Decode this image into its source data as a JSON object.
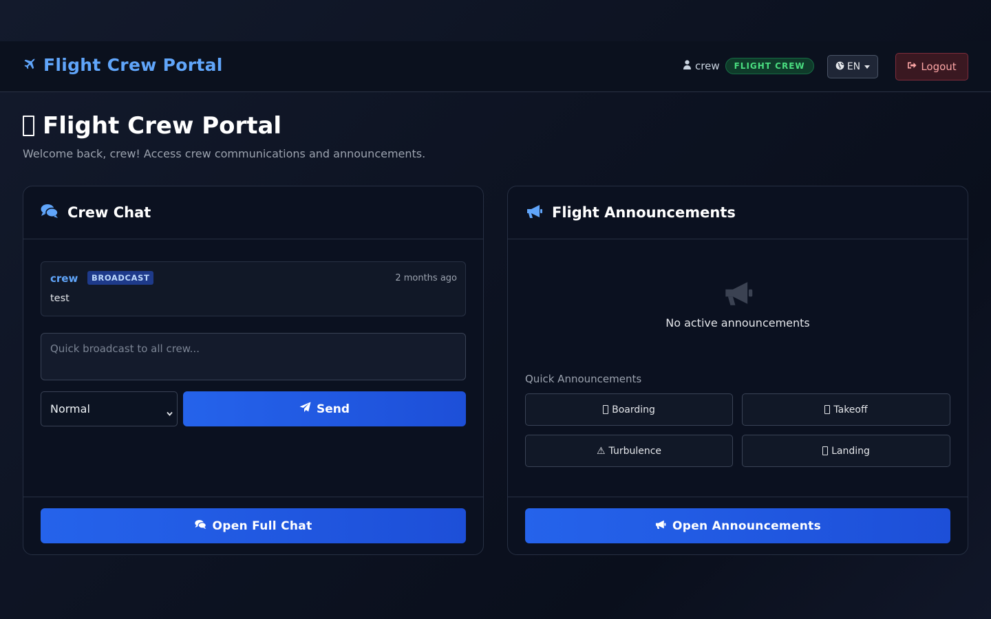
{
  "nav": {
    "brand": "Flight Crew Portal",
    "username": "crew",
    "role_badge": "FLIGHT CREW",
    "language": "EN",
    "logout_label": "Logout"
  },
  "page": {
    "title": "Flight Crew Portal",
    "subtitle": "Welcome back, crew! Access crew communications and announcements."
  },
  "crew_chat": {
    "title": "Crew Chat",
    "messages": [
      {
        "user": "crew",
        "badge": "BROADCAST",
        "time": "2 months ago",
        "text": "test"
      }
    ],
    "input_placeholder": "Quick broadcast to all crew...",
    "priority_selected": "Normal",
    "send_label": "Send",
    "open_label": "Open Full Chat"
  },
  "announcements": {
    "title": "Flight Announcements",
    "empty_text": "No active announcements",
    "quick_label": "Quick Announcements",
    "quick_items": [
      {
        "label": "Boarding",
        "icon": "tofu-glyph"
      },
      {
        "label": "Takeoff",
        "icon": "tofu-glyph"
      },
      {
        "label": "Turbulence",
        "icon": "⚠"
      },
      {
        "label": "Landing",
        "icon": "tofu-glyph"
      }
    ],
    "open_label": "Open Announcements"
  },
  "colors": {
    "accent": "#2563eb",
    "brand": "#60a5fa",
    "role_badge": "#4ade80",
    "logout": "#fca5a5"
  }
}
